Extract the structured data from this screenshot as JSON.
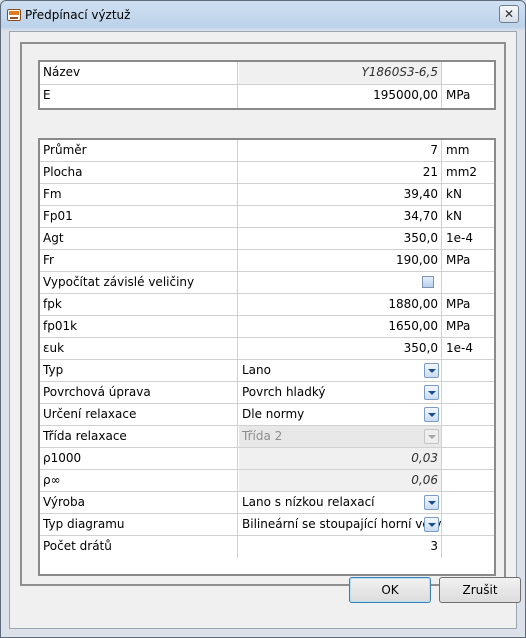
{
  "window": {
    "title": "Předpínací výztuž",
    "close_glyph": "✕"
  },
  "section1": [
    {
      "label": "Název",
      "value": "Y1860S3-6,5",
      "unit": ""
    },
    {
      "label": "E",
      "value": "195000,00",
      "unit": "MPa"
    }
  ],
  "section2": [
    {
      "label": "Průměr",
      "value": "7",
      "unit": "mm"
    },
    {
      "label": "Plocha",
      "value": "21",
      "unit": "mm2"
    },
    {
      "label": "Fm",
      "value": "39,40",
      "unit": "kN"
    },
    {
      "label": "Fp01",
      "value": "34,70",
      "unit": "kN"
    },
    {
      "label": "Agt",
      "value": "350,0",
      "unit": "1e-4"
    },
    {
      "label": "Fr",
      "value": "190,00",
      "unit": "MPa"
    },
    {
      "label": "Vypočítat závislé veličiny",
      "checked": false
    },
    {
      "label": "fpk",
      "value": "1880,00",
      "unit": "MPa"
    },
    {
      "label": "fp01k",
      "value": "1650,00",
      "unit": "MPa"
    },
    {
      "label": "εuk",
      "value": "350,0",
      "unit": "1e-4"
    },
    {
      "label": "Typ",
      "value": "Lano"
    },
    {
      "label": "Povrchová úprava",
      "value": "Povrch hladký"
    },
    {
      "label": "Určení relaxace",
      "value": "Dle normy"
    },
    {
      "label": "Třída relaxace",
      "value": "Třída 2"
    },
    {
      "label": "ρ1000",
      "value": "0,03"
    },
    {
      "label": "ρ∞",
      "value": "0,06"
    },
    {
      "label": "Výroba",
      "value": "Lano s nízkou relaxací"
    },
    {
      "label": "Typ diagramu",
      "value": "Bilineární se stoupající horní větví"
    },
    {
      "label": "Počet drátů",
      "value": "3"
    }
  ],
  "buttons": {
    "ok": "OK",
    "cancel": "Zrušit"
  },
  "colors": {
    "accent": "#1d4e8c",
    "readonly_bg": "#f0f0f0"
  }
}
